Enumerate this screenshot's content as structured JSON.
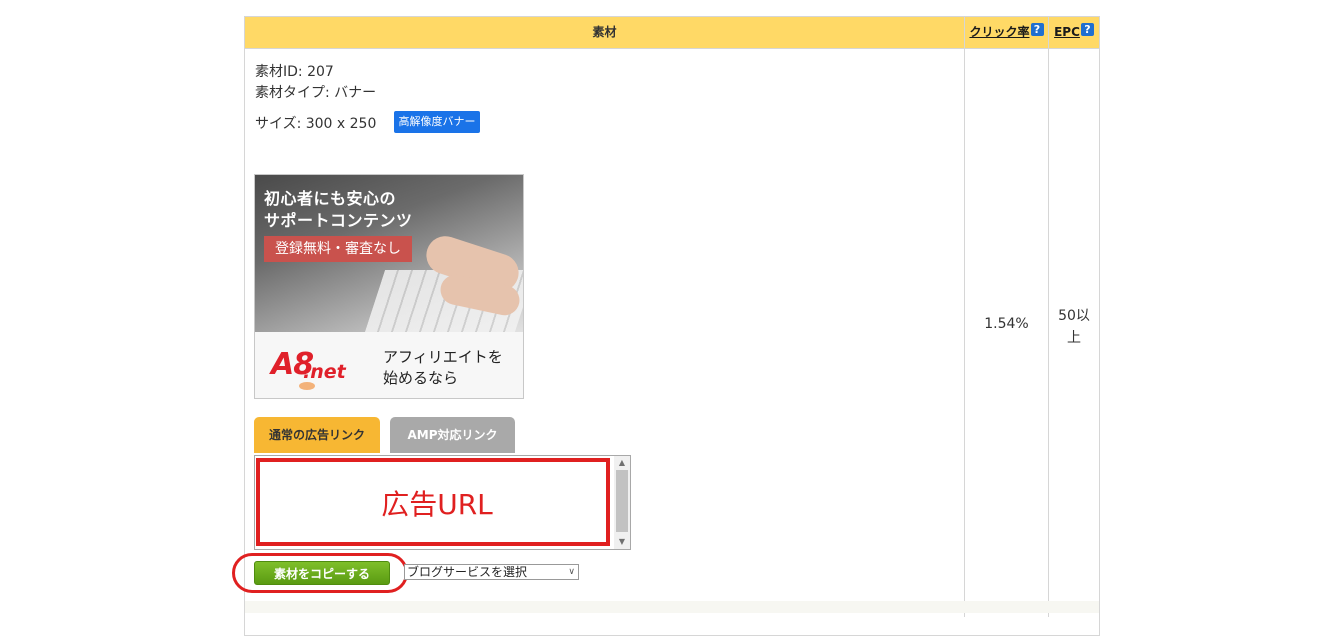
{
  "table": {
    "headers": {
      "material": "素材",
      "click_rate": "クリック率",
      "epc": "EPC",
      "help_glyph": "?"
    }
  },
  "material": {
    "id_line": "素材ID: 207",
    "type_line": "素材タイプ: バナー",
    "size_line": "サイズ: 300 x 250",
    "badge": "高解像度バナー"
  },
  "banner": {
    "line1": "初心者にも安心の",
    "line2": "サポートコンテンツ",
    "red_label": "登録無料・審査なし",
    "logo_a8": "A8",
    "logo_net": ".net",
    "copy1": "アフィリエイトを",
    "copy2": "始めるなら"
  },
  "tabs": [
    {
      "label": "通常の広告リンク",
      "active": true
    },
    {
      "label": "AMP対応リンク",
      "active": false
    }
  ],
  "code_area": {
    "annotation": "広告URL"
  },
  "actions": {
    "copy_button": "素材をコピーする",
    "blog_select_value": "ブログサービスを選択"
  },
  "metrics": {
    "click_rate": "1.54%",
    "epc_line1": "50以",
    "epc_line2": "上"
  },
  "colors": {
    "header_bg": "#ffd966",
    "badge_bg": "#1a73e8",
    "active_tab": "#f7b733",
    "inactive_tab": "#a9a9a9",
    "copy_button": "#6aaa1c",
    "annotation_red": "#e02020"
  }
}
